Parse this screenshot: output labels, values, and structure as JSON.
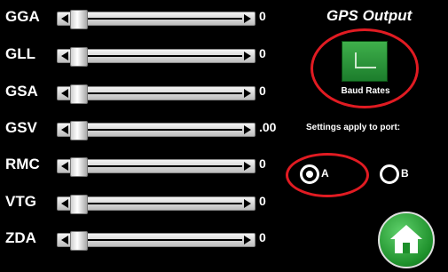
{
  "panel": {
    "title": "GPS Output",
    "baud_rates_label": "Baud Rates",
    "settings_text": "Settings apply to port:",
    "port_options": [
      {
        "label": "A",
        "selected": true
      },
      {
        "label": "B",
        "selected": false
      }
    ]
  },
  "sentences": [
    {
      "label": "GGA",
      "value": "0"
    },
    {
      "label": "GLL",
      "value": "0"
    },
    {
      "label": "GSA",
      "value": "0"
    },
    {
      "label": "GSV",
      "value": ".00"
    },
    {
      "label": "RMC",
      "value": "0"
    },
    {
      "label": "VTG",
      "value": "0"
    },
    {
      "label": "ZDA",
      "value": "0"
    }
  ],
  "icons": {
    "baud": "baud-rate-icon",
    "home": "home-icon"
  },
  "colors": {
    "background": "#000000",
    "highlight_ring": "#e11b22",
    "button_green": "#2fa33c"
  }
}
